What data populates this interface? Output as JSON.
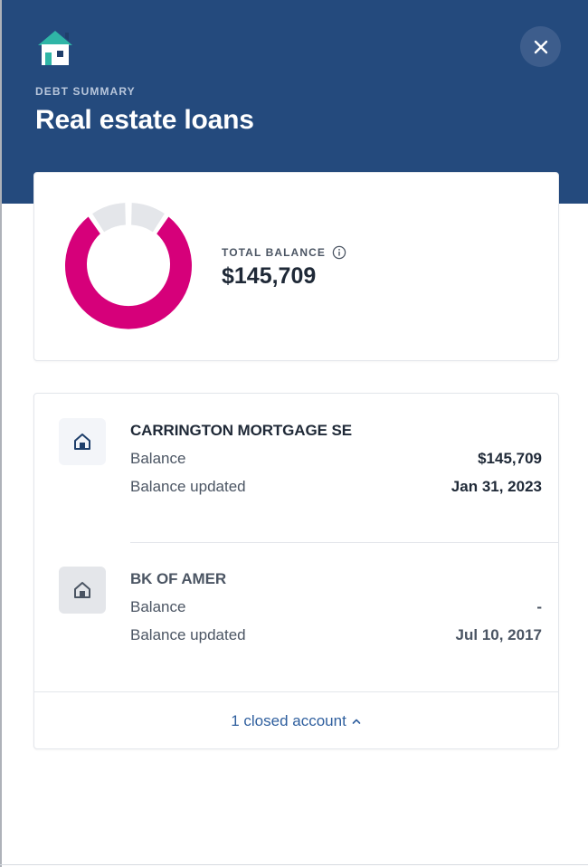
{
  "header": {
    "eyebrow": "DEBT SUMMARY",
    "title": "Real estate loans",
    "logo_icon": "house-icon",
    "close_icon": "close-icon"
  },
  "summary": {
    "total_label": "TOTAL BALANCE",
    "total_value": "$145,709",
    "info_icon": "info-icon",
    "chart_colors": {
      "active": "#d6007a",
      "inactive": "#e4e6ea"
    }
  },
  "accounts": [
    {
      "name": "CARRINGTON MORTGAGE SE",
      "icon": "home-icon",
      "balance_label": "Balance",
      "balance_value": "$145,709",
      "updated_label": "Balance updated",
      "updated_value": "Jan 31, 2023"
    },
    {
      "name": "BK OF AMER",
      "icon": "home-icon",
      "balance_label": "Balance",
      "balance_value": "-",
      "updated_label": "Balance updated",
      "updated_value": "Jul 10, 2017"
    }
  ],
  "footer": {
    "closed_link": "1 closed account",
    "chevron_icon": "chevron-up-icon"
  },
  "colors": {
    "header_bg": "#244a7d",
    "accent_pink": "#d6007a",
    "link_blue": "#2f5f9e"
  }
}
